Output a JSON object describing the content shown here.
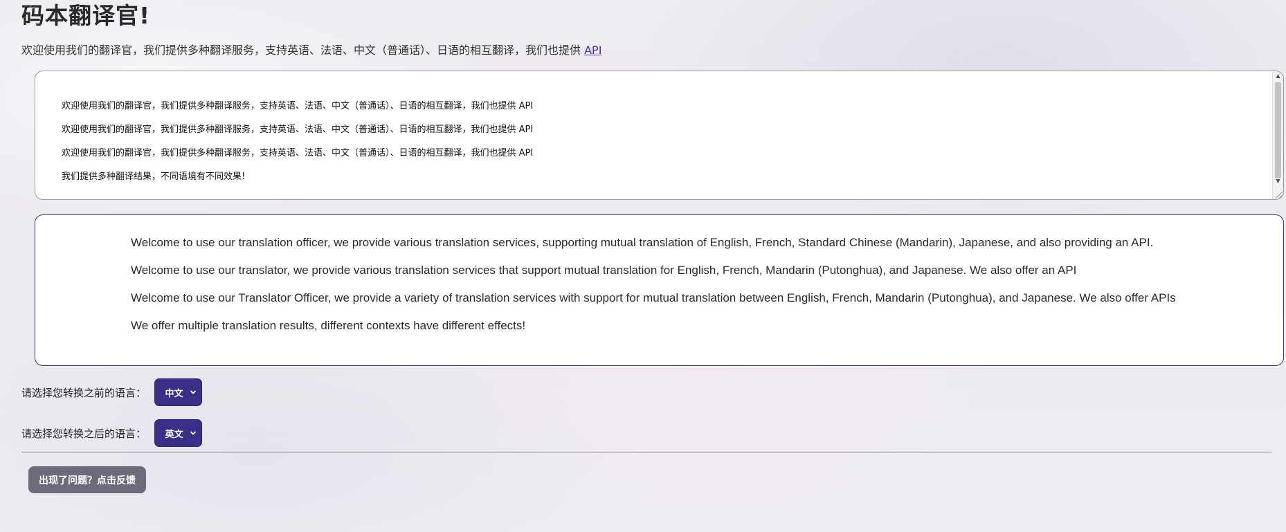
{
  "header": {
    "title": "码本翻译官!",
    "intro_text": "欢迎使用我们的翻译官，我们提供多种翻译服务，支持英语、法语、中文（普通话）、日语的相互翻译，我们也提供 ",
    "api_link": "API"
  },
  "source_box": {
    "lines": [
      "欢迎使用我们的翻译官，我们提供多种翻译服务，支持英语、法语、中文（普通话）、日语的相互翻译，我们也提供 API",
      "欢迎使用我们的翻译官，我们提供多种翻译服务，支持英语、法语、中文（普通话）、日语的相互翻译，我们也提供 API",
      "欢迎使用我们的翻译官，我们提供多种翻译服务，支持英语、法语、中文（普通话）、日语的相互翻译，我们也提供 API",
      "我们提供多种翻译结果，不同语境有不同效果!"
    ],
    "scroll_up_icon": "▲",
    "scroll_down_icon": "▼"
  },
  "result_box": {
    "lines": [
      "Welcome to use our translation officer, we provide various translation services, supporting mutual translation of English, French, Standard Chinese (Mandarin), Japanese, and also providing an API.",
      "Welcome to use our translator, we provide various translation services that support mutual translation for English, French, Mandarin (Putonghua), and Japanese. We also offer an API",
      "Welcome to use our Translator Officer, we provide a variety of translation services with support for mutual translation between English, French, Mandarin (Putonghua), and Japanese. We also offer APIs",
      "We offer multiple translation results, different contexts have different effects!"
    ]
  },
  "source_lang": {
    "label": "请选择您转换之前的语言：",
    "selected": "中文"
  },
  "target_lang": {
    "label": "请选择您转换之后的语言：",
    "selected": "英文"
  },
  "feedback": {
    "label": "出现了问题？点击反馈"
  },
  "colors": {
    "select_bg": "#3a2f86",
    "button_bg": "#6c6a7b",
    "link": "#4b2ea3"
  },
  "icons": {
    "select_chevron": "chevron-down-icon"
  }
}
